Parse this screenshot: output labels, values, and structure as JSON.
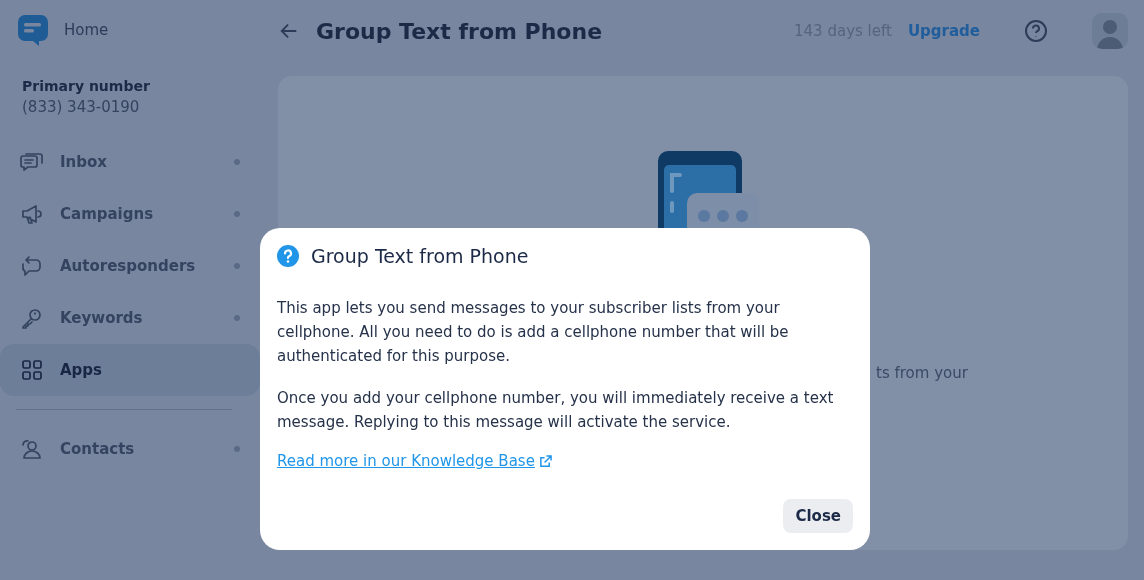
{
  "sidebar": {
    "home": "Home",
    "primary_label": "Primary number",
    "primary_number": "(833) 343-0190",
    "items": [
      {
        "kind": "inbox",
        "label": "Inbox",
        "selected": false
      },
      {
        "kind": "campaigns",
        "label": "Campaigns",
        "selected": false
      },
      {
        "kind": "autoresponders",
        "label": "Autoresponders",
        "selected": false
      },
      {
        "kind": "keywords",
        "label": "Keywords",
        "selected": false
      },
      {
        "kind": "apps",
        "label": "Apps",
        "selected": true
      },
      {
        "kind": "contacts",
        "label": "Contacts",
        "selected": false
      }
    ]
  },
  "header": {
    "title": "Group Text from Phone",
    "trial": "143 days left",
    "upgrade": "Upgrade"
  },
  "card": {
    "partial_text": "ts from your"
  },
  "dialog": {
    "title": "Group Text from Phone",
    "paragraphs": [
      "This app lets you send messages to your subscriber lists from your cellphone. All you need to do is add a cellphone number that will be authenticated for this purpose.",
      "Once you add your cellphone number, you will immediately receive a text message. Replying to this message will activate the service."
    ],
    "link": "Read more in our Knowledge Base",
    "button": "Close"
  }
}
